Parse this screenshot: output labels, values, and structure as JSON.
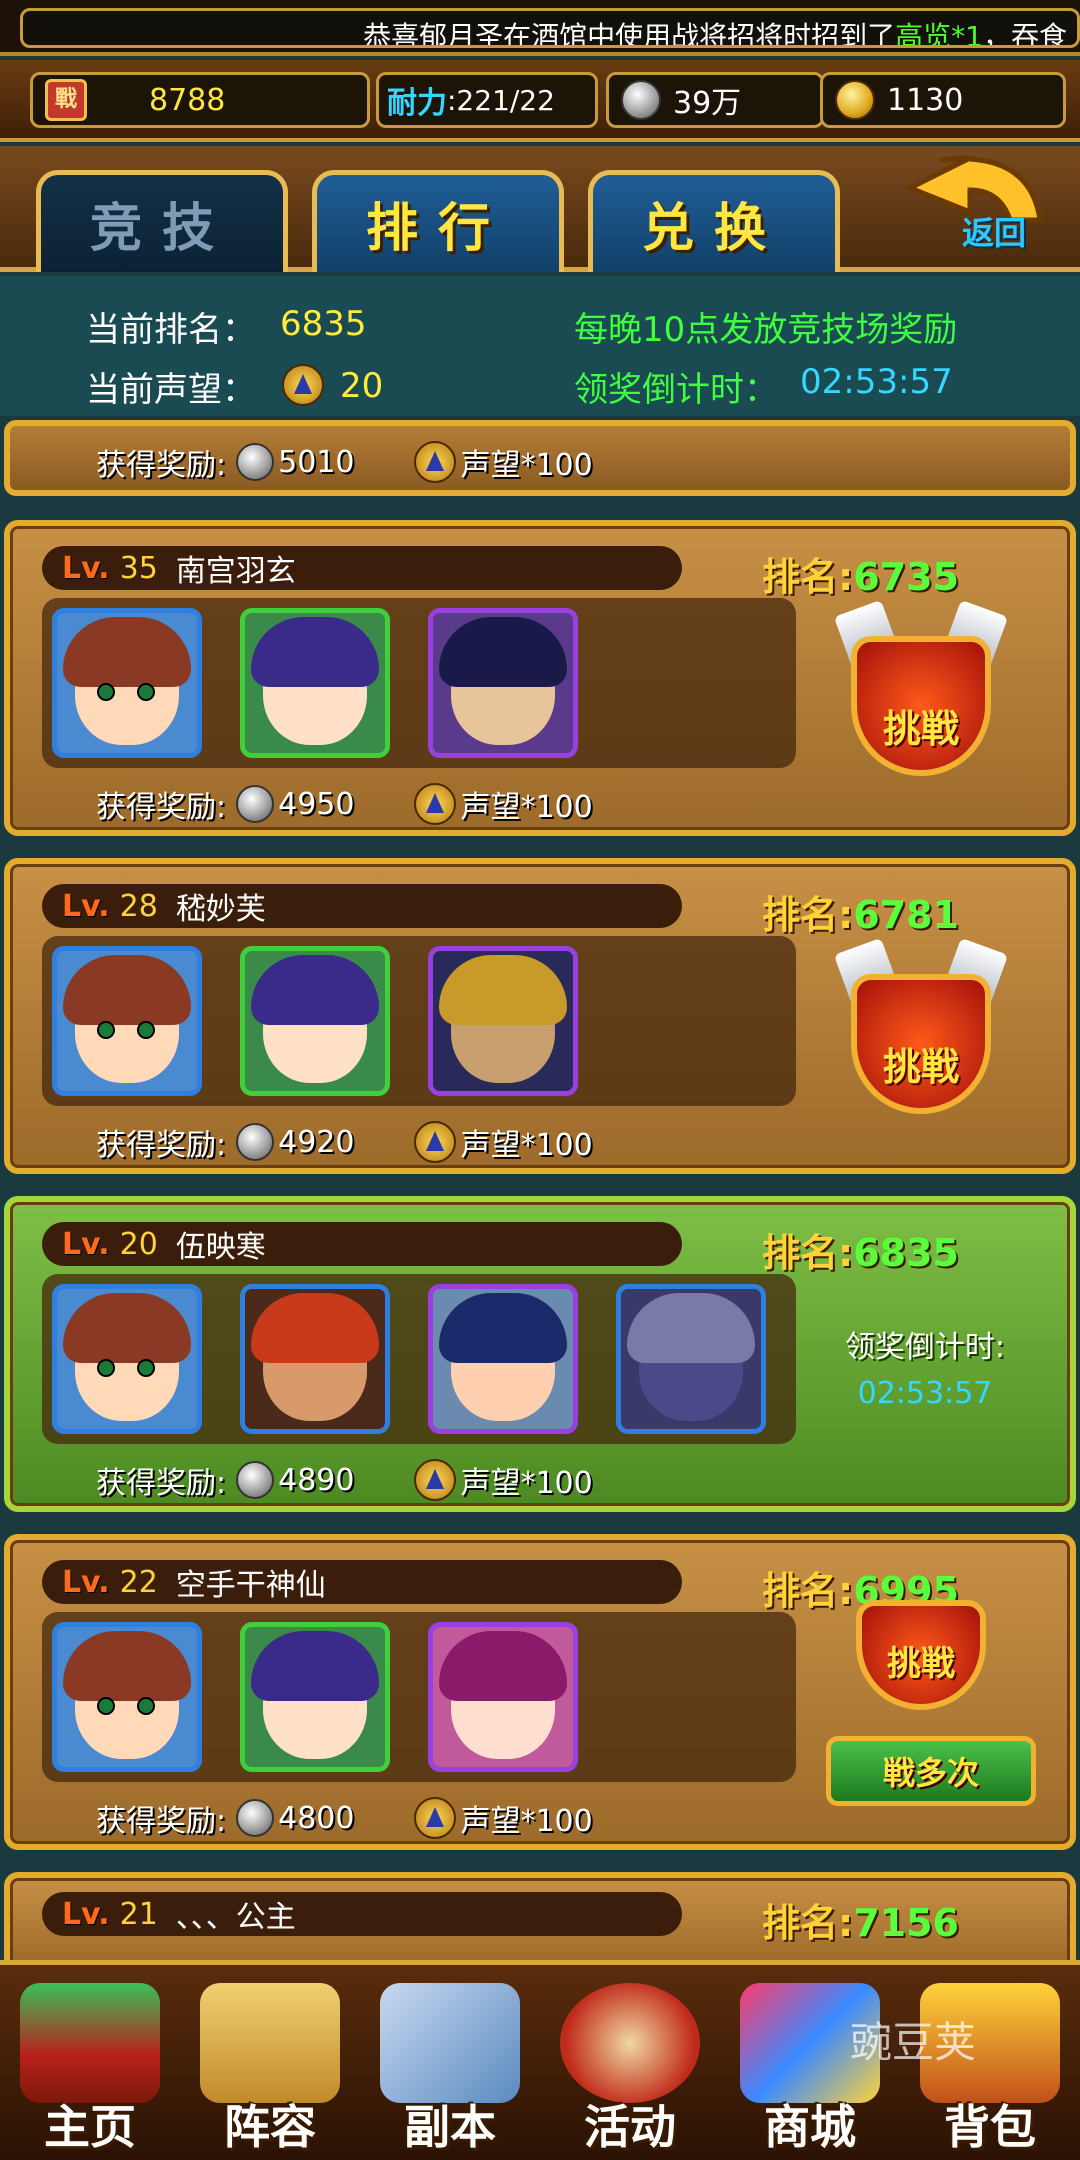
{
  "marquee": {
    "text_before": "恭喜郁月圣在酒馆中使用战将招将时招到了",
    "highlight": "高览*1",
    "text_after": "，吞食"
  },
  "resources": {
    "battle_icon_label": "戰",
    "power": "8788",
    "stamina_label": "耐力",
    "stamina_value": ":221/22",
    "silver": "39万",
    "gold": "1130"
  },
  "tabs": [
    {
      "label": "竞技",
      "active": true
    },
    {
      "label": "排行",
      "active": false
    },
    {
      "label": "兑换",
      "active": false
    }
  ],
  "back_label": "返回",
  "info": {
    "rank_label": "当前排名：",
    "rank_value": "6835",
    "prestige_label": "当前声望：",
    "prestige_value": "20",
    "notice": "每晚10点发放竞技场奖励",
    "countdown_label": "领奖倒计时：",
    "countdown_value": "02:53:57"
  },
  "top_reward": {
    "label": "获得奖励:",
    "silver": "5010",
    "prestige": "声望*100"
  },
  "opponents": [
    {
      "lv_label": "Lv.",
      "level": "35",
      "name": "南宫羽玄",
      "rank_label": "排名:",
      "rank": "6735",
      "reward_label": "获得奖励:",
      "silver": "4950",
      "prestige": "声望*100",
      "action": "挑戦"
    },
    {
      "lv_label": "Lv.",
      "level": "28",
      "name": "嵇妙芙",
      "rank_label": "排名:",
      "rank": "6781",
      "reward_label": "获得奖励:",
      "silver": "4920",
      "prestige": "声望*100",
      "action": "挑戦"
    },
    {
      "lv_label": "Lv.",
      "level": "20",
      "name": "伍映寒",
      "rank_label": "排名:",
      "rank": "6835",
      "reward_label": "获得奖励:",
      "silver": "4890",
      "prestige": "声望*100",
      "countdown_label": "领奖倒计时:",
      "countdown": "02:53:57"
    },
    {
      "lv_label": "Lv.",
      "level": "22",
      "name": "空手干神仙",
      "rank_label": "排名:",
      "rank": "6995",
      "reward_label": "获得奖励:",
      "silver": "4800",
      "prestige": "声望*100",
      "action": "挑戦",
      "multi": "戦多次"
    },
    {
      "lv_label": "Lv.",
      "level": "21",
      "name": "、、、公主",
      "rank_label": "排名:",
      "rank": "7156"
    }
  ],
  "nav": [
    {
      "label": "主页"
    },
    {
      "label": "阵容"
    },
    {
      "label": "副本"
    },
    {
      "label": "活动"
    },
    {
      "label": "商城"
    },
    {
      "label": "背包"
    }
  ],
  "watermark": "豌豆荚",
  "colors": {
    "gold_border": "#e3ac2e",
    "rank_green": "#58ff3a",
    "cyan": "#35d6ff"
  }
}
